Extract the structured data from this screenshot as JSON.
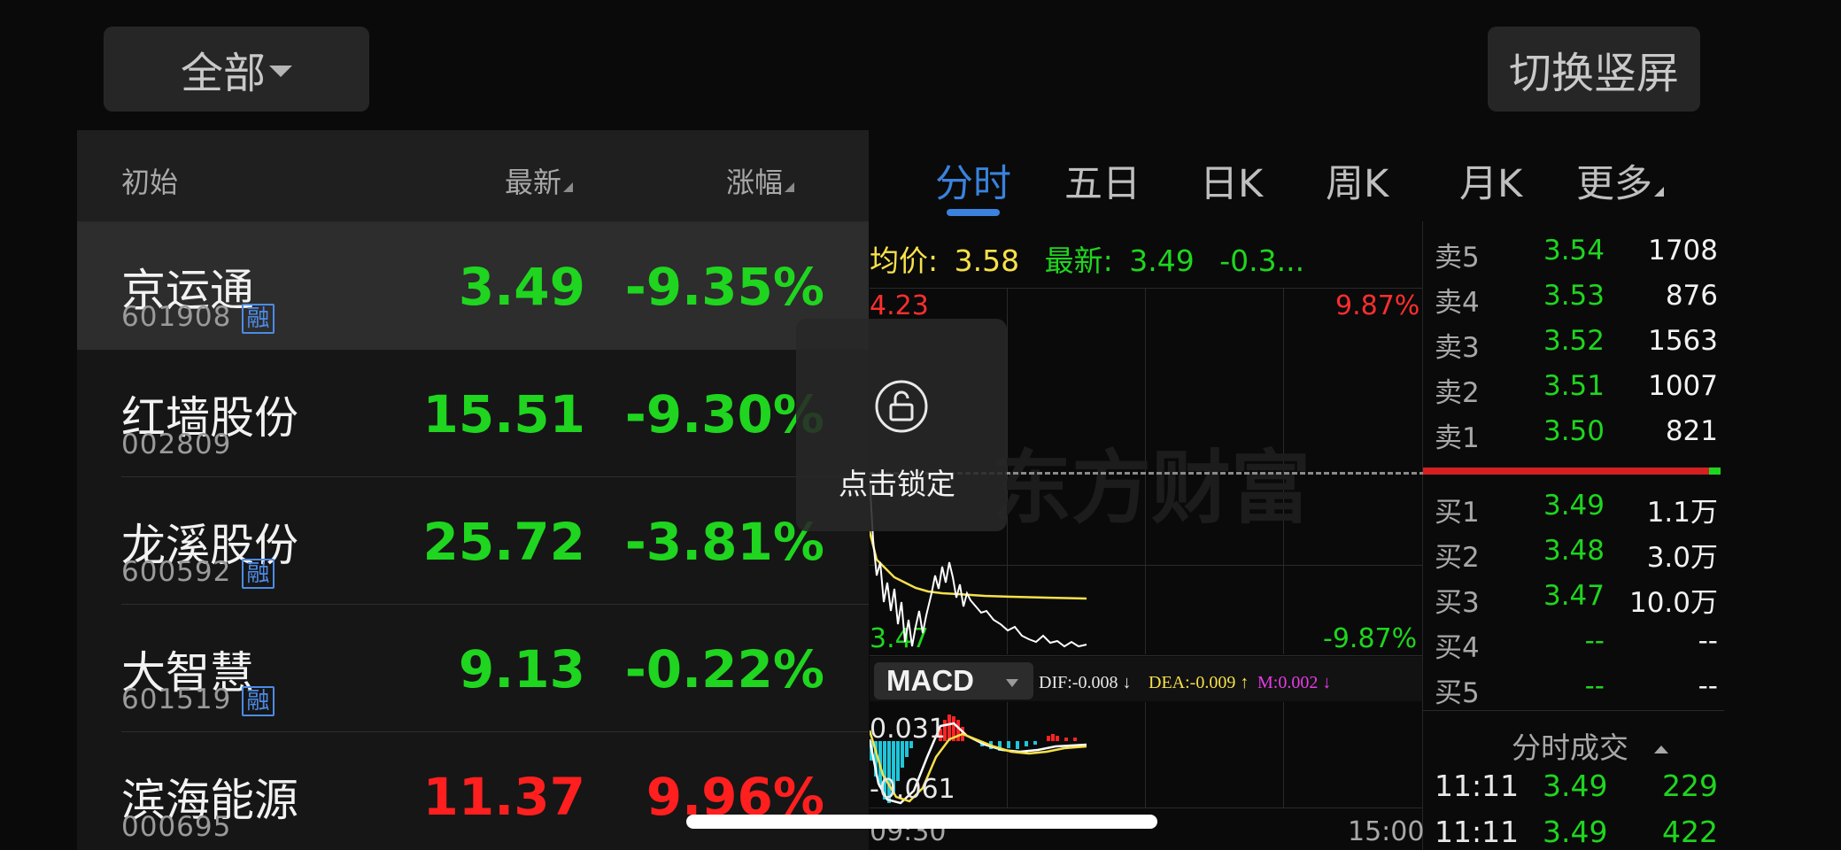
{
  "top": {
    "filter_label": "全部",
    "switch_label": "切换竖屏"
  },
  "list": {
    "headers": {
      "name": "初始",
      "latest": "最新",
      "change": "涨幅"
    },
    "rows": [
      {
        "name": "京运通",
        "code": "601908",
        "margin": "融",
        "price": "3.49",
        "change": "-9.35%",
        "trend": "down"
      },
      {
        "name": "红墙股份",
        "code": "002809",
        "margin": "",
        "price": "15.51",
        "change": "-9.30%",
        "trend": "down"
      },
      {
        "name": "龙溪股份",
        "code": "600592",
        "margin": "融",
        "price": "25.72",
        "change": "-3.81%",
        "trend": "down"
      },
      {
        "name": "大智慧",
        "code": "601519",
        "margin": "融",
        "price": "9.13",
        "change": "-0.22%",
        "trend": "down"
      },
      {
        "name": "滨海能源",
        "code": "000695",
        "margin": "",
        "price": "11.37",
        "change": "9.96%",
        "trend": "up"
      }
    ]
  },
  "tabs": [
    "分时",
    "五日",
    "日K",
    "周K",
    "月K",
    "更多"
  ],
  "chart": {
    "avg_label": "均价:",
    "avg_value": "3.58",
    "latest_label": "最新:",
    "latest_value": "3.49",
    "latest_change": "-0.3...",
    "y_top": "4.23",
    "y_top_pct": "9.87%",
    "y_bottom": "3.47",
    "y_bottom_pct": "-9.87%",
    "watermark": "东方财富",
    "x_start": "09:30",
    "x_end": "15:00"
  },
  "macd": {
    "selector": "MACD",
    "dif": "DIF:-0.008 ↓",
    "dea": "DEA:-0.009 ↑",
    "m": "M:0.002 ↓",
    "y_top": "0.031",
    "y_bottom": "-0.061"
  },
  "order_book": {
    "asks": [
      {
        "label": "卖5",
        "price": "3.54",
        "volume": "1708"
      },
      {
        "label": "卖4",
        "price": "3.53",
        "volume": "876"
      },
      {
        "label": "卖3",
        "price": "3.52",
        "volume": "1563"
      },
      {
        "label": "卖2",
        "price": "3.51",
        "volume": "1007"
      },
      {
        "label": "卖1",
        "price": "3.50",
        "volume": "821"
      }
    ],
    "bids": [
      {
        "label": "买1",
        "price": "3.49",
        "volume": "1.1万"
      },
      {
        "label": "买2",
        "price": "3.48",
        "volume": "3.0万"
      },
      {
        "label": "买3",
        "price": "3.47",
        "volume": "10.0万"
      },
      {
        "label": "买4",
        "price": "--",
        "volume": "--"
      },
      {
        "label": "买5",
        "price": "--",
        "volume": "--"
      }
    ]
  },
  "trades": {
    "title": "分时成交",
    "rows": [
      {
        "time": "11:11",
        "price": "3.49",
        "volume": "229"
      },
      {
        "time": "11:11",
        "price": "3.49",
        "volume": "422"
      }
    ]
  },
  "lock": {
    "label": "点击锁定",
    "icon": "unlock-icon"
  },
  "colors": {
    "accent": "#3a82dc",
    "up": "#ff1f1f",
    "down": "#1fd51f",
    "avg": "#f7e14a"
  }
}
